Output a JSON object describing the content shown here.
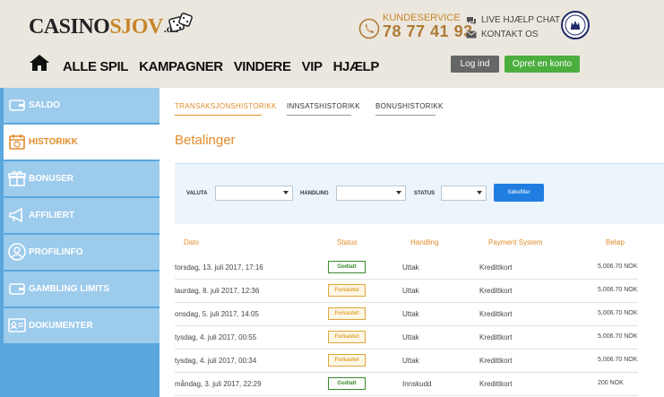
{
  "brand": {
    "logo_part1": "CASINO",
    "logo_part2": "SJOV",
    "logo_part3": ".dk"
  },
  "header": {
    "kundeservice_label": "KUNDESERVICE",
    "phone": "78 77 41 93",
    "live_chat": "LIVE HJÆLP CHAT",
    "contact": "KONTAKT OS",
    "login_button": "Log ind",
    "register_button": "Opret en konto"
  },
  "nav": {
    "items": [
      "ALLE SPIL",
      "KAMPAGNER",
      "VINDERE",
      "VIP",
      "HJÆLP"
    ]
  },
  "sidebar": {
    "items": [
      {
        "label": "SALDO",
        "icon": "wallet-icon"
      },
      {
        "label": "HISTORIKK",
        "icon": "calendar-icon"
      },
      {
        "label": "BONUSER",
        "icon": "gift-icon"
      },
      {
        "label": "AFFILIERT",
        "icon": "megaphone-icon"
      },
      {
        "label": "PROFILINFO",
        "icon": "user-icon"
      },
      {
        "label": "GAMBLING LIMITS",
        "icon": "wallet-icon"
      },
      {
        "label": "DOKUMENTER",
        "icon": "id-card-icon"
      }
    ],
    "active": "HISTORIKK"
  },
  "tabs": [
    {
      "label": "TRANSAKSJONSHISTORIKK"
    },
    {
      "label": "INNSATSHISTORIKK"
    },
    {
      "label": "BONUSHISTORIKK"
    }
  ],
  "section_title": "Betalinger",
  "filter": {
    "currency_label": "VALUTA",
    "action_label": "HANDLING",
    "status_label": "STATUS",
    "search_button": "Søkefilter"
  },
  "table": {
    "headers": [
      "Dato",
      "Status",
      "Handling",
      "Payment System",
      "Beløp"
    ],
    "rows": [
      {
        "date": "torsdag, 13. juli 2017, 17:16",
        "status": "Godtatt",
        "action": "Uttak",
        "system": "Kredittkort",
        "amount": "5,006.70 NOK"
      },
      {
        "date": "laurdag, 8. juli 2017, 12:36",
        "status": "Forkastet",
        "action": "Uttak",
        "system": "Kredittkort",
        "amount": "5,006.70 NOK"
      },
      {
        "date": "onsdag, 5. juli 2017, 14:05",
        "status": "Forkastet",
        "action": "Uttak",
        "system": "Kredittkort",
        "amount": "5,006.70 NOK"
      },
      {
        "date": "tysdag, 4. juli 2017, 00:55",
        "status": "Forkastet",
        "action": "Uttak",
        "system": "Kredittkort",
        "amount": "5,006.70 NOK"
      },
      {
        "date": "tysdag, 4. juli 2017, 00:34",
        "status": "Forkastet",
        "action": "Uttak",
        "system": "Kredittkort",
        "amount": "5,006.70 NOK"
      },
      {
        "date": "måndag, 3. juli 2017, 22:29",
        "status": "Godtatt",
        "action": "Innskudd",
        "system": "Kredittkort",
        "amount": "200 NOK"
      }
    ]
  },
  "colors": {
    "accent": "#e18c2a",
    "sidebar": "#5aa7de",
    "approved": "#3a8a2a",
    "rejected": "#e0a43a",
    "primary_button": "#1f7ee0"
  }
}
